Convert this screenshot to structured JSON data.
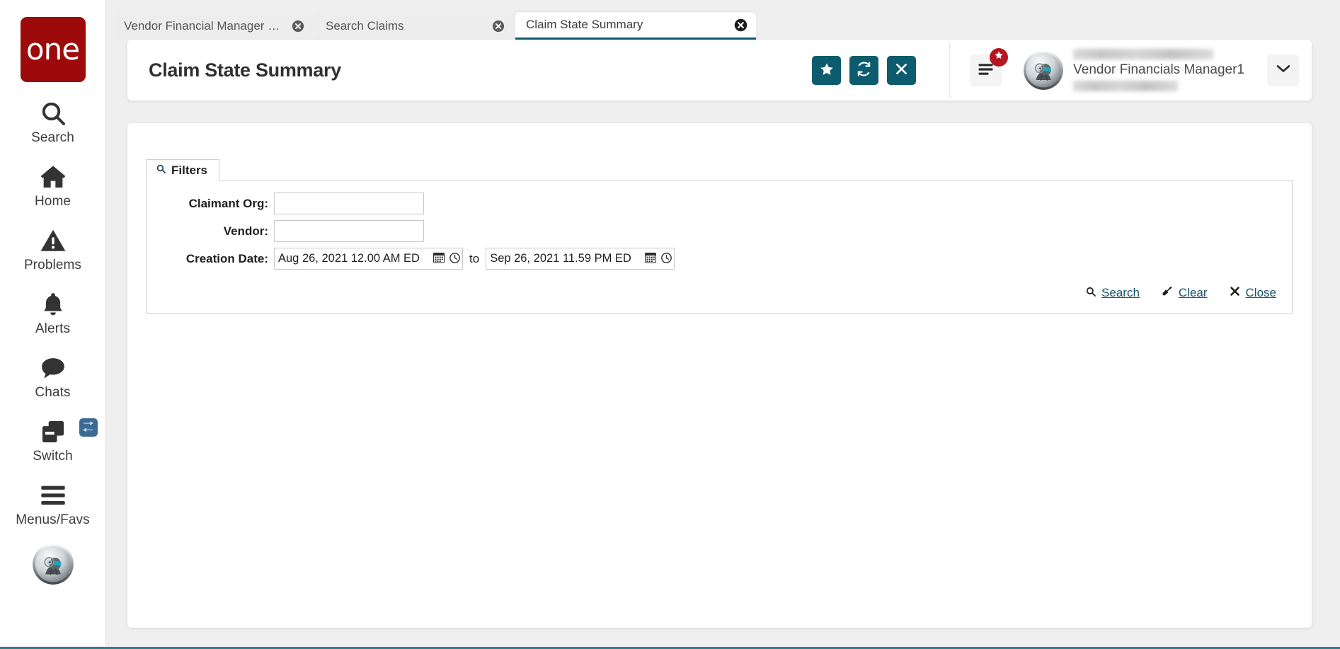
{
  "app": {
    "logo_text": "one",
    "accent_teal": "#0d5c6e",
    "accent_link": "#14556b",
    "logo_red": "#9c0a0a",
    "badge_red": "#b5161f",
    "switch_blue": "#3b6b94",
    "bottom_rule": "#2d7f92"
  },
  "sidebar": {
    "items": [
      {
        "label": "Search",
        "icon": "search-icon"
      },
      {
        "label": "Home",
        "icon": "home-icon"
      },
      {
        "label": "Problems",
        "icon": "warning-triangle-icon"
      },
      {
        "label": "Alerts",
        "icon": "bell-icon"
      },
      {
        "label": "Chats",
        "icon": "chat-bubble-icon"
      },
      {
        "label": "Switch",
        "icon": "switch-windows-icon",
        "badge_icon": "swap-arrows-icon"
      },
      {
        "label": "Menus/Favs",
        "icon": "hamburger-icon"
      }
    ],
    "avatar_icon": "robot-avatar"
  },
  "tabs": [
    {
      "label": "Vendor Financial Manager Dash...",
      "active": false,
      "close_icon": "close-circle-icon"
    },
    {
      "label": "Search Claims",
      "active": false,
      "close_icon": "close-circle-icon"
    },
    {
      "label": "Claim State Summary",
      "active": true,
      "close_icon": "close-circle-icon"
    }
  ],
  "header": {
    "title": "Claim State Summary",
    "buttons": [
      {
        "name": "favorite-button",
        "icon": "star-icon"
      },
      {
        "name": "refresh-button",
        "icon": "refresh-icon"
      },
      {
        "name": "close-button",
        "icon": "x-icon"
      }
    ],
    "menu_icon": "hamburger-icon",
    "menu_badge_icon": "star-icon",
    "avatar_icon": "robot-avatar",
    "user_name": "Vendor Financials Manager1",
    "dropdown_icon": "chevron-down-icon"
  },
  "filters": {
    "tab_label": "Filters",
    "tab_icon": "search-icon",
    "fields": {
      "claimant_org": {
        "label": "Claimant Org:",
        "value": "",
        "placeholder": ""
      },
      "vendor": {
        "label": "Vendor:",
        "value": "",
        "placeholder": ""
      },
      "creation_date": {
        "label": "Creation Date:",
        "from_value": "Aug 26, 2021 12.00 AM ED",
        "to_value": "Sep 26, 2021 11.59 PM ED",
        "separator": "to",
        "calendar_icon": "calendar-icon",
        "clock_icon": "clock-icon"
      }
    },
    "actions": [
      {
        "label": "Search",
        "icon": "search-icon"
      },
      {
        "label": "Clear",
        "icon": "eraser-icon"
      },
      {
        "label": "Close",
        "icon": "x-icon"
      }
    ]
  }
}
